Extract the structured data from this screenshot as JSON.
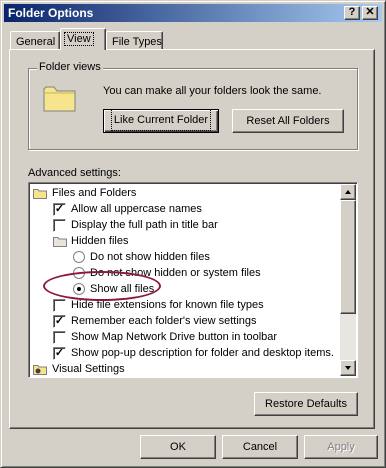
{
  "window": {
    "title": "Folder Options",
    "help_glyph": "?",
    "close_glyph": "✕"
  },
  "tabs": [
    {
      "label": "General",
      "active": false
    },
    {
      "label": "View",
      "active": true
    },
    {
      "label": "File Types",
      "active": false
    }
  ],
  "folder_views": {
    "group_label": "Folder views",
    "description": "You can make all your folders look the same.",
    "like_current_button": "Like Current Folder",
    "reset_all_button": "Reset All Folders",
    "folder_icon": "folder-icon"
  },
  "advanced": {
    "label": "Advanced settings:",
    "items": [
      {
        "type": "folder",
        "text": "Files and Folders"
      },
      {
        "type": "checkbox",
        "checked": true,
        "text": "Allow all uppercase names"
      },
      {
        "type": "checkbox",
        "checked": false,
        "text": "Display the full path in title bar"
      },
      {
        "type": "folder",
        "text": "Hidden files"
      },
      {
        "type": "radio",
        "checked": false,
        "text": "Do not show hidden files"
      },
      {
        "type": "radio",
        "checked": false,
        "text": "Do not show hidden or system files"
      },
      {
        "type": "radio",
        "checked": true,
        "text": "Show all files"
      },
      {
        "type": "checkbox",
        "checked": false,
        "text": "Hide file extensions for known file types"
      },
      {
        "type": "checkbox",
        "checked": true,
        "text": "Remember each folder's view settings"
      },
      {
        "type": "checkbox",
        "checked": false,
        "text": "Show Map Network Drive button in toolbar"
      },
      {
        "type": "checkbox",
        "checked": true,
        "text": "Show pop-up description for folder and desktop items."
      },
      {
        "type": "settings-folder",
        "text": "Visual Settings"
      }
    ],
    "restore_defaults_button": "Restore Defaults"
  },
  "footer": {
    "ok": "OK",
    "cancel": "Cancel",
    "apply": "Apply"
  },
  "colors": {
    "annotation_oval": "#8b1a3a",
    "titlebar_start": "#0a246a",
    "titlebar_end": "#a6caf0"
  }
}
